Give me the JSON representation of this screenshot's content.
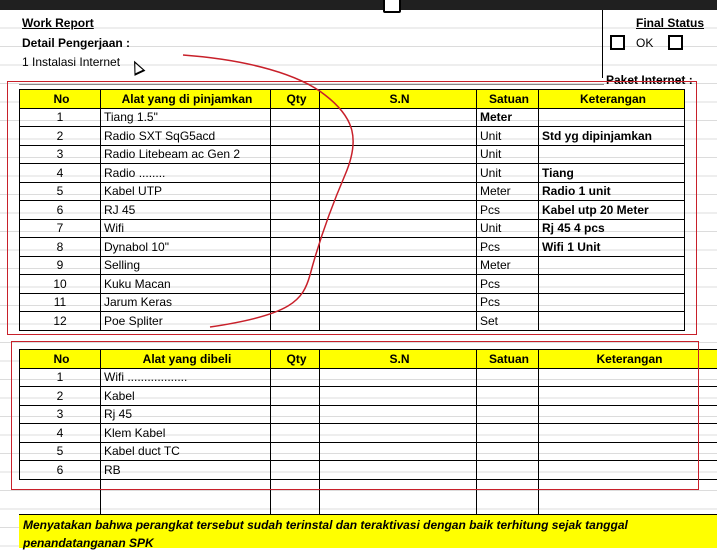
{
  "header": {
    "title": "Work Report",
    "subtitle": "Detail Pengerjaan :",
    "item": "1 Instalasi Internet",
    "final_status": "Final Status",
    "ok_label": "OK",
    "paket_internet": "Paket Internet :"
  },
  "table1": {
    "headers": [
      "No",
      "Alat yang di pinjamkan",
      "Qty",
      "S.N",
      "Satuan",
      "Keterangan"
    ],
    "rows": [
      {
        "no": "1",
        "alat": "Tiang 1.5\"",
        "qty": "",
        "sn": "",
        "satuan": "Meter",
        "ket": ""
      },
      {
        "no": "2",
        "alat": "Radio SXT SqG5acd",
        "qty": "",
        "sn": "",
        "satuan": "Unit",
        "ket": "Std yg dipinjamkan"
      },
      {
        "no": "3",
        "alat": "Radio Litebeam ac Gen 2",
        "qty": "",
        "sn": "",
        "satuan": "Unit",
        "ket": ""
      },
      {
        "no": "4",
        "alat": "Radio ........",
        "qty": "",
        "sn": "",
        "satuan": "Unit",
        "ket": "Tiang"
      },
      {
        "no": "5",
        "alat": "Kabel UTP",
        "qty": "",
        "sn": "",
        "satuan": "Meter",
        "ket": "Radio 1 unit"
      },
      {
        "no": "6",
        "alat": "RJ 45",
        "qty": "",
        "sn": "",
        "satuan": "Pcs",
        "ket": "Kabel utp 20 Meter"
      },
      {
        "no": "7",
        "alat": "Wifi",
        "qty": "",
        "sn": "",
        "satuan": "Unit",
        "ket": "Rj 45 4 pcs"
      },
      {
        "no": "8",
        "alat": "Dynabol 10\"",
        "qty": "",
        "sn": "",
        "satuan": "Pcs",
        "ket": "Wifi 1 Unit"
      },
      {
        "no": "9",
        "alat": "Selling",
        "qty": "",
        "sn": "",
        "satuan": "Meter",
        "ket": ""
      },
      {
        "no": "10",
        "alat": "Kuku Macan",
        "qty": "",
        "sn": "",
        "satuan": "Pcs",
        "ket": ""
      },
      {
        "no": "11",
        "alat": "Jarum Keras",
        "qty": "",
        "sn": "",
        "satuan": "Pcs",
        "ket": ""
      },
      {
        "no": "12",
        "alat": "Poe Spliter",
        "qty": "",
        "sn": "",
        "satuan": "Set",
        "ket": ""
      }
    ]
  },
  "table2": {
    "headers": [
      "No",
      "Alat yang dibeli",
      "Qty",
      "S.N",
      "Satuan",
      "Keterangan"
    ],
    "rows": [
      {
        "no": "1",
        "alat": "Wifi ..................",
        "qty": "",
        "sn": "",
        "satuan": "",
        "ket": ""
      },
      {
        "no": "2",
        "alat": "Kabel",
        "qty": "",
        "sn": "",
        "satuan": "",
        "ket": ""
      },
      {
        "no": "3",
        "alat": "Rj 45",
        "qty": "",
        "sn": "",
        "satuan": "",
        "ket": ""
      },
      {
        "no": "4",
        "alat": "Klem Kabel",
        "qty": "",
        "sn": "",
        "satuan": "",
        "ket": ""
      },
      {
        "no": "5",
        "alat": "Kabel duct TC",
        "qty": "",
        "sn": "",
        "satuan": "",
        "ket": ""
      },
      {
        "no": "6",
        "alat": "RB",
        "qty": "",
        "sn": "",
        "satuan": "",
        "ket": ""
      }
    ]
  },
  "footer": {
    "line1": "Menyatakan bahwa perangkat tersebut sudah terinstal dan teraktivasi dengan baik terhitung sejak tanggal",
    "line2": "penandatanganan SPK"
  },
  "colors": {
    "header_fill": "#ffff00",
    "annotation_red": "#c8202a"
  }
}
